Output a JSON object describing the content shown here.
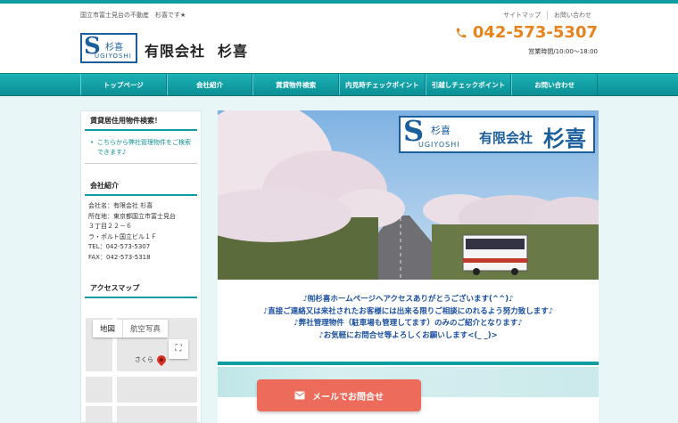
{
  "header": {
    "tagline": "国立市富士見台の不動産　杉喜です★",
    "logo": {
      "letter": "S",
      "kanji": "杉喜",
      "roman": "UGIYOSHI"
    },
    "company_name_prefix": "有限会社",
    "company_name_main": "杉喜",
    "toplinks": [
      "サイトマップ",
      "お問い合わせ"
    ],
    "phone": "042-573-5307",
    "hours": "営業時間/10:00〜18:00"
  },
  "nav": {
    "items": [
      "トップページ",
      "会社紹介",
      "賃貸物件検索",
      "内見時チェックポイント",
      "引越しチェックポイント",
      "お問い合わせ"
    ]
  },
  "sidebar": {
    "search_heading": "賃貸居住用物件検索！",
    "search_link": "こちらから弊社管理物件をご検索できます♪",
    "company_heading": "会社紹介",
    "company_lines": [
      "会社名：有限会社 杉喜",
      "所在地：東京都国立市富士見台",
      "３丁目２２－６",
      "ラ・ポルト国立ビル１Ｆ",
      "TEL：042-573-5307",
      "FAX：042-573-5318"
    ],
    "access_heading": "アクセスマップ",
    "map": {
      "tab_map": "地図",
      "tab_satellite": "航空写真",
      "place_label": "さくら"
    }
  },
  "banner": {
    "logo_letter": "S",
    "logo_kanji": "杉喜",
    "logo_roman": "UGIYOSHI",
    "company_text": "有限会社",
    "company_big": "杉喜"
  },
  "main": {
    "welcome_lines": [
      "♪㈲杉喜ホームページへアクセスありがとうございます(^^)♪",
      "♪直接ご連絡又は来社されたお客様には出来る限りご相談にのれるよう努力致します♪",
      "♪弊社管理物件（駐車場も管理してます）のみのご紹介となります♪",
      "♪お気軽にお問合せ等よろしくお願いします<(_ _)>"
    ]
  },
  "mail_button": {
    "label": "メールでお問合せ"
  },
  "colors": {
    "teal": "#0e9da2",
    "orange": "#e8831c",
    "coral": "#ec6b5a",
    "blue": "#1a4fa0"
  }
}
